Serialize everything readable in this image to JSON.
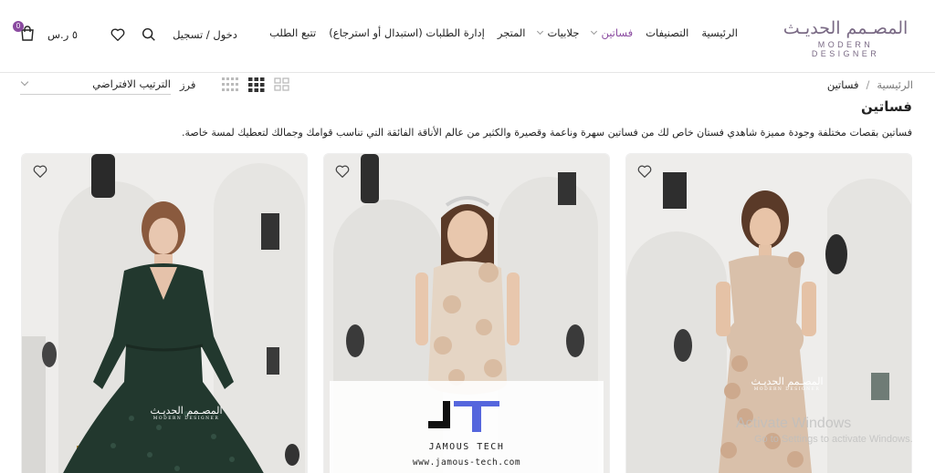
{
  "header": {
    "logo_ar": "المصـمم الحديـث",
    "logo_en": "MODERN DESIGNER",
    "nav": [
      {
        "label": "الرئيسية",
        "active": false,
        "dropdown": false
      },
      {
        "label": "التصنيفات",
        "active": false,
        "dropdown": false
      },
      {
        "label": "فساتين",
        "active": true,
        "dropdown": true
      },
      {
        "label": "جلابيات",
        "active": false,
        "dropdown": true
      },
      {
        "label": "المتجر",
        "active": false,
        "dropdown": false
      },
      {
        "label": "إدارة الطلبات (استبدال أو استرجاع)",
        "active": false,
        "dropdown": false
      },
      {
        "label": "تتبع الطلب",
        "active": false,
        "dropdown": false
      }
    ],
    "login_label": "دخول / تسجيل",
    "cart_total": "٥ ر.س",
    "cart_count": "0",
    "icons": [
      "search-icon",
      "heart-icon",
      "cart-icon"
    ]
  },
  "breadcrumb": {
    "home": "الرئيسية",
    "separator": "/",
    "current": "فساتين"
  },
  "toolbar": {
    "sort_prefix": "فرز",
    "sort_value": "الترتيب الافتراضي",
    "grid_views": [
      "grid-2-icon",
      "grid-3-icon",
      "grid-4-icon"
    ],
    "active_grid": "grid-3-icon"
  },
  "category": {
    "title": "فساتين",
    "description": "فساتين بقصات مختلفة وجودة مميزة شاهدي فستان خاص لك من فساتين سهرة وناعمة وقصيرة والكثير من عالم الأناقة الفائقة التي تناسب قوامك وجمالك لتعطيك لمسة خاصة."
  },
  "products": [
    {
      "photo": "beige dress with 3D flowers",
      "watermark_ar": "المصـمم الحديـث",
      "watermark_en": "MODERN DESIGNER"
    },
    {
      "photo": "girl in beige dress with tiara",
      "watermark_ar": "",
      "watermark_en": ""
    },
    {
      "photo": "dark green lace gown",
      "watermark_ar": "المصـمم الحديـث",
      "watermark_en": "MODERN DESIGNER"
    }
  ],
  "overlay": {
    "brand": "JAMOUS TECH",
    "url": "www.jamous-tech.com"
  },
  "os_watermark": {
    "line1": "Activate Windows",
    "line2": "Go to Settings to activate Windows."
  },
  "colors": {
    "accent": "#8a4aa0",
    "logo": "#7a6a85"
  }
}
